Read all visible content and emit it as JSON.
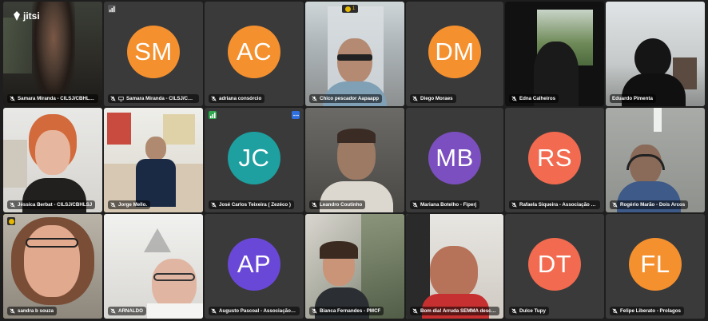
{
  "app": {
    "logo_text": "jitsi"
  },
  "colors": {
    "orange": "#f5902e",
    "teal": "#1ea0a0",
    "purple": "#7b4fbf",
    "coral": "#f26a4f",
    "blurple": "#6a48d7",
    "active_border": "#4a90e2",
    "speaker_border": "#e6b800"
  },
  "tiles": [
    {
      "name": "Samara Miranda - CILSJ/CBHLSJ",
      "type": "video",
      "icon": "mic-muted-icon"
    },
    {
      "name": "Samara Miranda - CILSJ/CBHLSJ",
      "type": "avatar",
      "initials": "SM",
      "color": "#f5902e",
      "icon": "mic-muted-icon",
      "badge": "signal-icon"
    },
    {
      "name": "adriana consórcio",
      "type": "avatar",
      "initials": "AC",
      "color": "#f5902e",
      "icon": "mic-muted-icon"
    },
    {
      "name": "Chico pescador Aapaapp",
      "type": "video",
      "icon": "mic-muted-icon",
      "badge": "raised-hand-icon",
      "badge_count": "1"
    },
    {
      "name": "Diego Moraes",
      "type": "avatar",
      "initials": "DM",
      "color": "#f5902e",
      "icon": "mic-muted-icon"
    },
    {
      "name": "Edna Calheiros",
      "type": "video",
      "icon": "mic-muted-icon"
    },
    {
      "name": "Eduardo Pimenta",
      "type": "video",
      "icon": "mic-muted-icon",
      "active": true
    },
    {
      "name": "Jéssica Berbat - CILSJ/CBHLSJ",
      "type": "video",
      "icon": "mic-muted-icon"
    },
    {
      "name": "Jorge Mello.",
      "type": "video",
      "icon": "mic-muted-icon"
    },
    {
      "name": "José Carlos Teixeira ( Zezéco )",
      "type": "avatar",
      "initials": "JC",
      "color": "#1ea0a0",
      "icon": "mic-muted-icon",
      "badge": "signal-icon",
      "more": true
    },
    {
      "name": "Leandro Coutinho",
      "type": "video",
      "icon": "mic-muted-icon"
    },
    {
      "name": "Mariana Botelho - Fiperj",
      "type": "avatar",
      "initials": "MB",
      "color": "#7b4fbf",
      "icon": "mic-muted-icon"
    },
    {
      "name": "Rafaela Siqueira - Associação Raízes",
      "type": "avatar",
      "initials": "RS",
      "color": "#f26a4f",
      "icon": "mic-muted-icon"
    },
    {
      "name": "Rogério Marão - Dois Arcos",
      "type": "video",
      "icon": "mic-muted-icon"
    },
    {
      "name": "sandra b souza",
      "type": "video",
      "icon": "mic-muted-icon",
      "speaker": true,
      "badge": "raised-hand-icon"
    },
    {
      "name": "ARNALDO",
      "type": "video",
      "icon": "mic-muted-icon"
    },
    {
      "name": "Augusto Pascoal - Associação Raí...",
      "type": "avatar",
      "initials": "AP",
      "color": "#6a48d7",
      "icon": "mic-muted-icon"
    },
    {
      "name": "Bianca Fernandes - PMCF",
      "type": "video",
      "icon": "mic-muted-icon"
    },
    {
      "name": "Bom dia! Arruda SEMMA desculpa ...",
      "type": "video",
      "icon": "mic-muted-icon"
    },
    {
      "name": "Dulce Tupy",
      "type": "avatar",
      "initials": "DT",
      "color": "#f26a4f",
      "icon": "mic-muted-icon"
    },
    {
      "name": "Felipe Liberato - Prolagos",
      "type": "avatar",
      "initials": "FL",
      "color": "#f5902e",
      "icon": "mic-muted-icon"
    }
  ]
}
